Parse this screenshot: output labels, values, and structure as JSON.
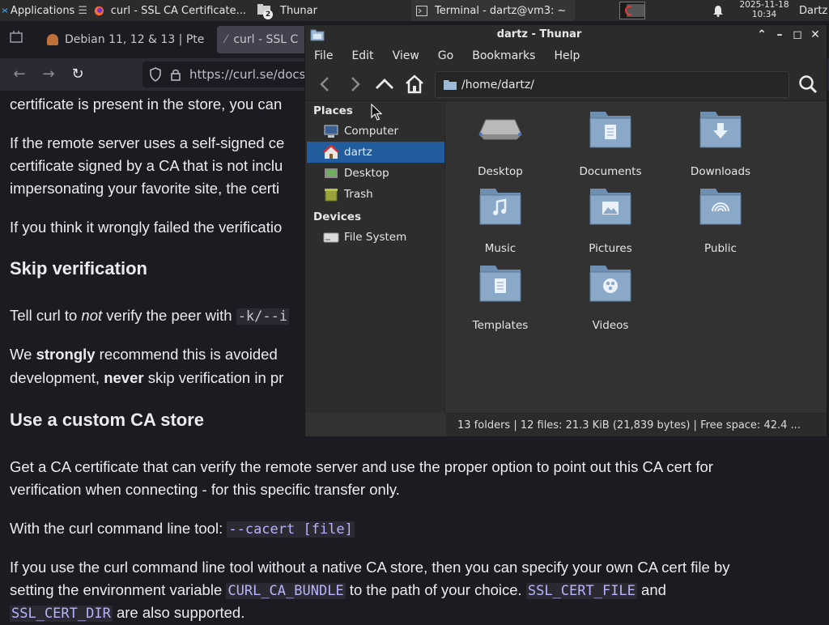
{
  "panel": {
    "applications": "Applications",
    "tasks": [
      {
        "label": "curl - SSL CA Certificate..."
      },
      {
        "label": "Thunar",
        "badge": "2"
      },
      {
        "label": "Terminal - dartz@vm3: ~"
      }
    ],
    "clock_date": "2025-11-18",
    "clock_time": "10:34",
    "user": "Dartz"
  },
  "browser": {
    "tabs": [
      {
        "label": "Debian 11, 12 & 13 | Pte"
      },
      {
        "label": "curl - SSL C"
      }
    ],
    "url": "https://curl.se/docs/",
    "content": {
      "line1": "certificate is present in the store, you can",
      "p2_l1": "If the remote server uses a self-signed ce",
      "p2_l2": "certificate signed by a CA that is not inclu",
      "p2_l3": "impersonating your favorite site, the certi",
      "p3": "If you think it wrongly failed the verificatio",
      "h_skip": "Skip verification",
      "p4_pre": "Tell curl to ",
      "p4_em": "not",
      "p4_post": " verify the peer with ",
      "p4_code": "-k/--i",
      "p5_a": "We ",
      "p5_b": "strongly",
      "p5_c": " recommend this is avoided",
      "p5_d": "development, ",
      "p5_e": "never",
      "p5_f": " skip verification in pr",
      "h_custom": "Use a custom CA store",
      "p6_l1": "Get a CA certificate that can verify the remote server and use the proper option to point out this CA cert for",
      "p6_l2": "verification when connecting - for this specific transfer only.",
      "p7_pre": "With the curl command line tool: ",
      "p7_code": "--cacert [file]",
      "p8_l1": "If you use the curl command line tool without a native CA store, then you can specify your own CA cert file by",
      "p8_l2a": "setting the environment variable ",
      "p8_code1": "CURL_CA_BUNDLE",
      "p8_l2b": " to the path of your choice. ",
      "p8_code2": "SSL_CERT_FILE",
      "p8_l2c": " and",
      "p8_code3": "SSL_CERT_DIR",
      "p8_l3": " are also supported."
    }
  },
  "thunar": {
    "title": "dartz - Thunar",
    "menu": [
      "File",
      "Edit",
      "View",
      "Go",
      "Bookmarks",
      "Help"
    ],
    "location": "/home/dartz/",
    "places_header": "Places",
    "places": [
      "Computer",
      "dartz",
      "Desktop",
      "Trash"
    ],
    "devices_header": "Devices",
    "devices": [
      "File System"
    ],
    "folders": [
      "Desktop",
      "Documents",
      "Downloads",
      "Music",
      "Pictures",
      "Public",
      "Templates",
      "Videos"
    ],
    "status": "13 folders  |  12 files: 21.3 KiB (21,839 bytes)  |  Free space: 42.4 ..."
  },
  "colors": {
    "selection": "#215d9c",
    "folder": "#8aa9c9",
    "code": "#b7b4ff"
  }
}
